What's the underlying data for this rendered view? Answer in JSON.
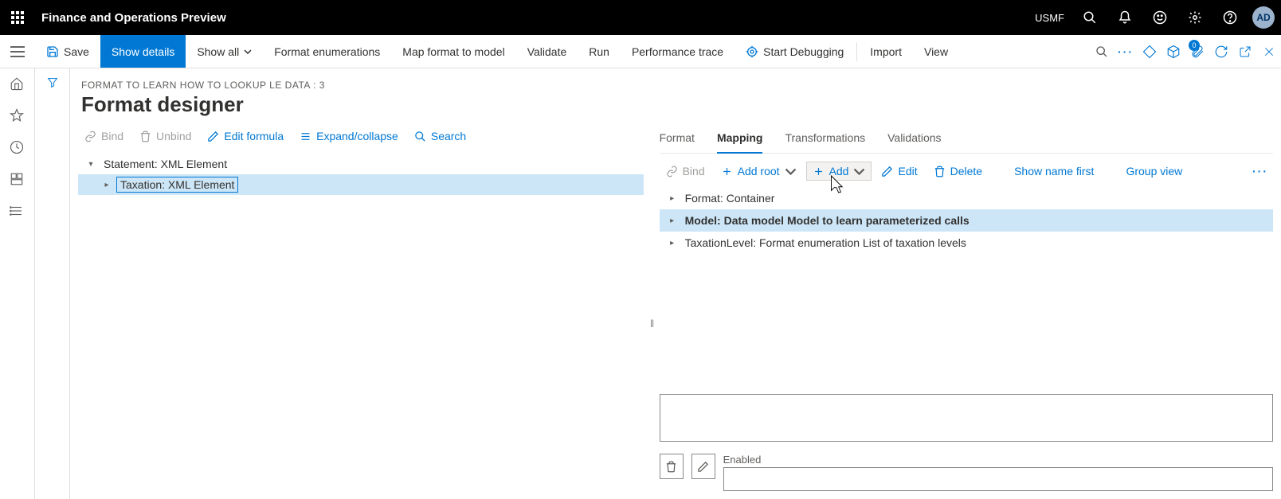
{
  "top": {
    "app_title": "Finance and Operations Preview",
    "company": "USMF",
    "avatar_initials": "AD"
  },
  "cmd": {
    "save": "Save",
    "show_details": "Show details",
    "show_all": "Show all",
    "format_enum": "Format enumerations",
    "map_format": "Map format to model",
    "validate": "Validate",
    "run": "Run",
    "perf_trace": "Performance trace",
    "start_debug": "Start Debugging",
    "import": "Import",
    "view": "View",
    "badge_count": "0"
  },
  "page": {
    "breadcrumb": "FORMAT TO LEARN HOW TO LOOKUP LE DATA : 3",
    "title": "Format designer"
  },
  "left_toolbar": {
    "bind": "Bind",
    "unbind": "Unbind",
    "edit_formula": "Edit formula",
    "expand": "Expand/collapse",
    "search": "Search"
  },
  "left_tree": {
    "root": "Statement: XML Element",
    "child": "Taxation: XML Element"
  },
  "right_tabs": {
    "format": "Format",
    "mapping": "Mapping",
    "transformations": "Transformations",
    "validations": "Validations"
  },
  "right_toolbar": {
    "bind": "Bind",
    "add_root": "Add root",
    "add": "Add",
    "edit": "Edit",
    "delete": "Delete",
    "show_name_first": "Show name first",
    "group_view": "Group view"
  },
  "right_tree": {
    "r1": "Format: Container",
    "r2": "Model: Data model Model to learn parameterized calls",
    "r3": "TaxationLevel: Format enumeration List of taxation levels"
  },
  "bottom": {
    "enabled_label": "Enabled"
  }
}
